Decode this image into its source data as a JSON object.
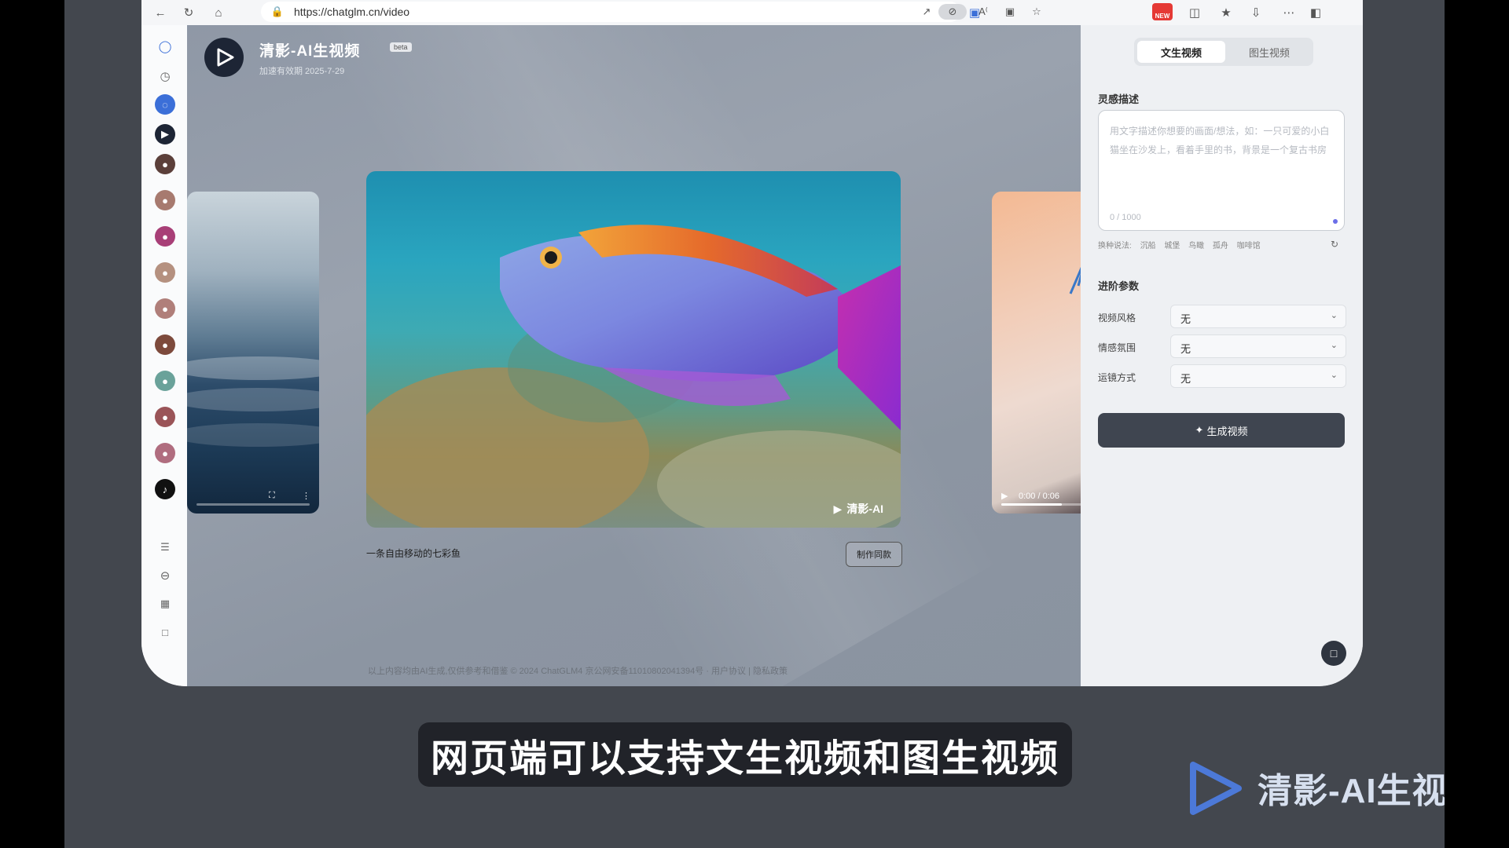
{
  "browser": {
    "url": "https://chatglm.cn/video",
    "new_badge": "NEW"
  },
  "app": {
    "title": "清影-AI生视频",
    "beta_label": "beta",
    "subtitle": "加速有效期 2025-7-29"
  },
  "gallery": {
    "center_watermark": "清影-AI",
    "caption": "一条自由移动的七彩鱼",
    "make_same_label": "制作同款",
    "right_video": {
      "time": "0:00 / 0:06",
      "progress": 0.55
    },
    "left_video": {
      "progress": 0.0
    }
  },
  "footer": {
    "text": "以上内容均由AI生成,仅供参考和借鉴    © 2024 ChatGLM4 京公网安备11010802041394号 ·    用户协议  |  隐私政策"
  },
  "panel": {
    "tabs": [
      {
        "label": "文生视频",
        "active": true
      },
      {
        "label": "图生视频",
        "active": false
      }
    ],
    "prompt_section_title": "灵感描述",
    "prompt_placeholder": "用文字描述你想要的画面/想法，如：一只可爱的小白猫坐在沙发上，看着手里的书，背景是一个复古书房",
    "prompt_count": "0 / 1000",
    "try_label": "换种说法:",
    "try_items": [
      "沉船",
      "城堡",
      "鸟瞰",
      "孤舟",
      "咖啡馆"
    ],
    "advanced_title": "进阶参数",
    "params": [
      {
        "label": "视频风格",
        "value": "无"
      },
      {
        "label": "情感氛围",
        "value": "无"
      },
      {
        "label": "运镜方式",
        "value": "无"
      }
    ],
    "generate_label": "生成视频"
  },
  "overlay": {
    "subtitle": "网页端可以支持文生视频和图生视频",
    "brand": "清影-AI生视频"
  },
  "colors": {
    "panel_bg": "#eef0f3",
    "generate_button": "#3f4550",
    "accent": "#6b6ee8"
  }
}
